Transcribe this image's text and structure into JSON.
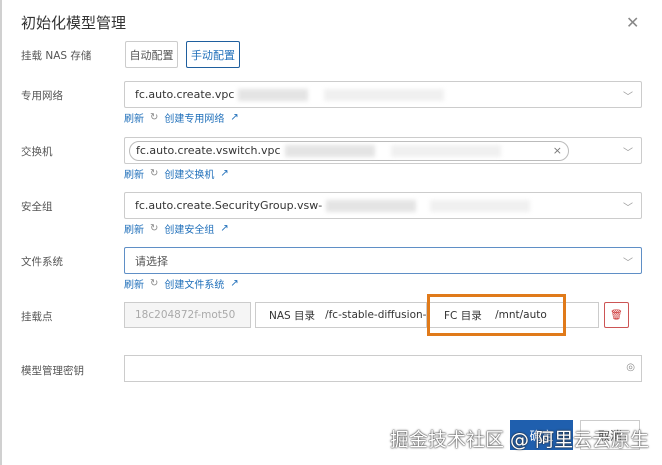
{
  "dialog": {
    "title": "初始化模型管理"
  },
  "nas": {
    "label": "挂载 NAS 存储",
    "auto": "自动配置",
    "manual": "手动配置"
  },
  "vpc": {
    "label": "专用网络",
    "value": "fc.auto.create.vpc",
    "refresh": "刷新",
    "create": "创建专用网络"
  },
  "vswitch": {
    "label": "交换机",
    "value": "fc.auto.create.vswitch.vpc",
    "refresh": "刷新",
    "create": "创建交换机"
  },
  "sg": {
    "label": "安全组",
    "value": "fc.auto.create.SecurityGroup.vsw-",
    "refresh": "刷新",
    "create": "创建安全组"
  },
  "fs": {
    "label": "文件系统",
    "placeholder": "请选择",
    "refresh": "刷新",
    "create": "创建文件系统"
  },
  "mount": {
    "label": "挂载点",
    "id": "18c204872f-mot50",
    "nas_label": "NAS 目录",
    "nas_value": "/fc-stable-diffusion-",
    "fc_label": "FC 目录",
    "fc_value": "/mnt/auto"
  },
  "key": {
    "label": "模型管理密钥"
  },
  "footer": {
    "ok": "确定",
    "cancel": "取消"
  },
  "watermark": "掘金技术社区 @ 阿里云云原生"
}
